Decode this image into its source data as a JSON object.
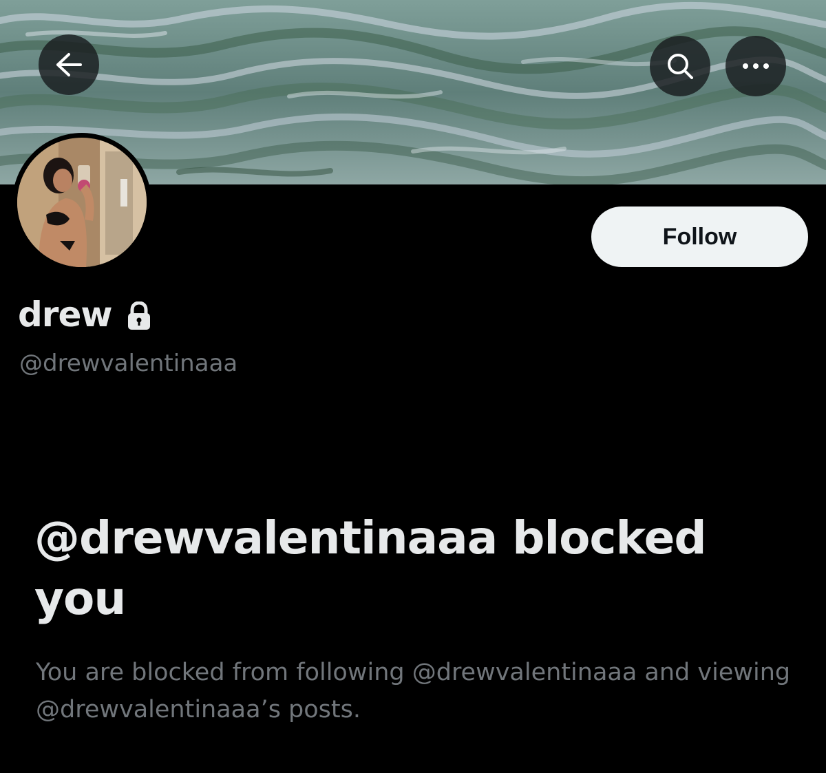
{
  "header": {
    "back_icon": "arrow-left-icon",
    "search_icon": "search-icon",
    "more_icon": "more-horizontal-icon"
  },
  "profile": {
    "display_name": "drew",
    "protected_icon": "lock-icon",
    "handle": "@drewvalentinaaa"
  },
  "actions": {
    "follow_label": "Follow"
  },
  "blocked_notice": {
    "title": "@drewvalentinaaa blocked you",
    "description": "You are blocked from following @drewvalentinaaa and viewing @drewvalentinaaa’s posts."
  },
  "colors": {
    "background": "#000000",
    "primary_text": "#e7e9ea",
    "secondary_text": "#71767b",
    "button_bg": "#eff3f4"
  }
}
